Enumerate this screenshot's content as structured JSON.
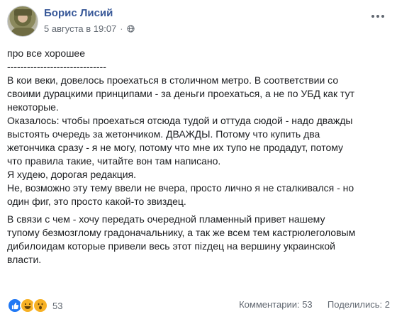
{
  "post": {
    "author": "Борис Лисий",
    "date": "5 августа в 19:07",
    "separator": "·",
    "paragraphs": [
      [
        "про все хорошее",
        "------------------------------",
        "В кои веки, довелось проехаться в столичном метро. В соответствии со",
        "своими дурацкими принципами - за деньги проехаться, а не по УБД как тут",
        "некоторые.",
        "Оказалось: чтобы проехаться отсюда тудой и оттуда сюдой - надо дважды",
        "выстоять очередь за жетончиком. ДВАЖДЫ. Потому что купить два",
        "жетончика сразу - я не могу, потому что мне их тупо не продадут, потому",
        "что правила такие, читайте вон там написано.",
        "Я худею, дорогая редакция.",
        "Не, возможно эту тему ввели не вчера, просто лично я не сталкивался - но",
        "один фиг, это просто какой-то звиздец."
      ],
      [
        "В связи с чем - хочу передать очередной пламенный привет нашему",
        "тупому безмозглому градоначальнику, а так же всем тем кастрюлеголовым",
        "дибилоидам которые привели весь этот пizдец на вершину украинской",
        "власти."
      ]
    ]
  },
  "footer": {
    "reactions": [
      "like",
      "haha",
      "wow"
    ],
    "reaction_count": "53",
    "comments": "Комментарии: 53",
    "shares": "Поделились: 2"
  },
  "colors": {
    "author": "#385898",
    "meta": "#606770",
    "text": "#1c1e21",
    "like": "#2078f4",
    "emoji": "#f7b125"
  }
}
